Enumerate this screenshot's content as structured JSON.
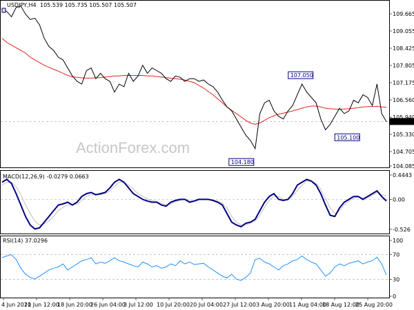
{
  "chart_data": [
    {
      "type": "candlestick",
      "panel": "price",
      "symbol_header": "USDJPY,H4",
      "ohlc_header": "105.539 105.735 105.507 105.507",
      "y_ticks": [
        "109.665",
        "109.055",
        "108.425",
        "107.805",
        "107.175",
        "106.560",
        "105.940",
        "105.330",
        "104.705",
        "104.085"
      ],
      "ylim": [
        103.8,
        110.0
      ],
      "last_price": "105.507",
      "annotations": [
        {
          "label": "107.050",
          "x": 64,
          "y": 107.05
        },
        {
          "label": "105.100",
          "x": 76,
          "y": 105.1
        },
        {
          "label": "104.180",
          "x": 54,
          "y": 104.18
        }
      ],
      "watermark": "ActionForex.com",
      "series": [
        {
          "name": "",
          "color": "#000000",
          "values": [
            109.7,
            109.6,
            109.4,
            109.75,
            109.8,
            109.5,
            109.3,
            109.35,
            109.1,
            108.6,
            108.3,
            108.15,
            107.9,
            107.8,
            107.5,
            107.2,
            107.0,
            106.9,
            107.4,
            107.5,
            107.1,
            107.3,
            107.1,
            107.0,
            106.6,
            106.9,
            106.8,
            107.3,
            107.0,
            107.2,
            107.6,
            107.3,
            107.5,
            107.4,
            107.3,
            107.1,
            107.0,
            107.2,
            107.15,
            107.0,
            107.1,
            107.1,
            107.0,
            107.05,
            106.9,
            106.8,
            106.6,
            106.3,
            106.05,
            105.9,
            105.6,
            105.3,
            105.0,
            104.8,
            104.5,
            105.8,
            106.2,
            106.3,
            105.9,
            105.7,
            105.6,
            105.9,
            106.1,
            106.5,
            106.9,
            106.6,
            106.4,
            106.2,
            105.6,
            105.2,
            105.4,
            105.7,
            106.0,
            105.8,
            105.9,
            106.3,
            106.2,
            106.5,
            106.4,
            106.1,
            106.9,
            105.8,
            105.5
          ]
        },
        {
          "name": "",
          "color": "#e02020",
          "values": [
            108.6,
            108.45,
            108.35,
            108.25,
            108.15,
            108.05,
            107.9,
            107.8,
            107.7,
            107.6,
            107.52,
            107.45,
            107.38,
            107.3,
            107.22,
            107.17,
            107.15,
            107.13,
            107.12,
            107.12,
            107.13,
            107.14,
            107.16,
            107.18,
            107.2,
            107.2,
            107.22,
            107.22,
            107.22,
            107.22,
            107.22,
            107.2,
            107.2,
            107.18,
            107.16,
            107.14,
            107.12,
            107.1,
            107.08,
            107.05,
            107.0,
            106.95,
            106.85,
            106.75,
            106.62,
            106.5,
            106.35,
            106.2,
            106.05,
            105.92,
            105.8,
            105.68,
            105.55,
            105.45,
            105.4,
            105.45,
            105.55,
            105.65,
            105.72,
            105.78,
            105.82,
            105.86,
            105.9,
            105.95,
            106.0,
            106.05,
            106.08,
            106.08,
            106.05,
            106.0,
            105.98,
            105.97,
            105.96,
            105.97,
            105.98,
            106.0,
            106.02,
            106.05,
            106.06,
            106.06,
            106.07,
            106.05,
            106.04
          ]
        }
      ]
    },
    {
      "type": "line",
      "panel": "macd",
      "label": "MACD(12,26,9) -0.0279 0.0663",
      "y_ticks": [
        "0.4443",
        "0.00",
        "-0.526"
      ],
      "ylim": [
        -0.6,
        0.5
      ],
      "series": [
        {
          "name": "",
          "color": "#000080",
          "values": [
            0.3,
            0.35,
            0.28,
            0.1,
            -0.1,
            -0.3,
            -0.45,
            -0.52,
            -0.5,
            -0.4,
            -0.3,
            -0.2,
            -0.1,
            -0.08,
            -0.05,
            -0.1,
            -0.05,
            0.05,
            0.1,
            0.12,
            0.08,
            0.1,
            0.12,
            0.2,
            0.3,
            0.35,
            0.3,
            0.2,
            0.1,
            0.05,
            0.0,
            -0.03,
            -0.05,
            -0.05,
            -0.1,
            -0.12,
            -0.05,
            -0.02,
            0.0,
            0.0,
            -0.05,
            -0.03,
            0.0,
            0.0,
            0.0,
            -0.02,
            -0.05,
            -0.1,
            -0.25,
            -0.4,
            -0.45,
            -0.48,
            -0.42,
            -0.4,
            -0.35,
            -0.2,
            -0.05,
            0.05,
            0.1,
            0.0,
            -0.02,
            0.0,
            0.1,
            0.25,
            0.3,
            0.35,
            0.32,
            0.25,
            0.1,
            -0.1,
            -0.28,
            -0.3,
            -0.15,
            -0.05,
            0.0,
            0.05,
            0.05,
            0.0,
            0.05,
            0.1,
            0.15,
            0.05,
            -0.03
          ]
        },
        {
          "name": "",
          "color": "#c0c0c0",
          "values": [
            0.25,
            0.3,
            0.3,
            0.22,
            0.08,
            -0.1,
            -0.25,
            -0.38,
            -0.45,
            -0.43,
            -0.38,
            -0.3,
            -0.2,
            -0.14,
            -0.1,
            -0.1,
            -0.08,
            -0.02,
            0.05,
            0.08,
            0.08,
            0.08,
            0.1,
            0.15,
            0.23,
            0.3,
            0.3,
            0.25,
            0.18,
            0.1,
            0.05,
            0.01,
            -0.02,
            -0.04,
            -0.07,
            -0.1,
            -0.08,
            -0.04,
            -0.02,
            0.0,
            -0.02,
            -0.03,
            -0.01,
            0.0,
            0.0,
            -0.01,
            -0.03,
            -0.07,
            -0.15,
            -0.3,
            -0.4,
            -0.45,
            -0.45,
            -0.42,
            -0.38,
            -0.28,
            -0.14,
            -0.02,
            0.06,
            0.05,
            0.0,
            -0.01,
            0.05,
            0.16,
            0.25,
            0.32,
            0.32,
            0.28,
            0.18,
            0.02,
            -0.15,
            -0.25,
            -0.2,
            -0.1,
            -0.03,
            0.02,
            0.04,
            0.02,
            0.03,
            0.07,
            0.12,
            0.08,
            0.07
          ]
        }
      ]
    },
    {
      "type": "line",
      "panel": "rsi",
      "label": "RSI(14) 37.0296",
      "y_ticks": [
        "100",
        "70",
        "30",
        "0"
      ],
      "ylim": [
        0,
        100
      ],
      "series": [
        {
          "name": "",
          "color": "#1e90ff",
          "values": [
            65,
            68,
            70,
            62,
            48,
            38,
            33,
            30,
            35,
            40,
            45,
            48,
            50,
            55,
            45,
            50,
            55,
            60,
            62,
            65,
            55,
            58,
            56,
            60,
            65,
            60,
            58,
            55,
            52,
            50,
            58,
            55,
            50,
            52,
            48,
            50,
            55,
            52,
            60,
            55,
            58,
            54,
            55,
            56,
            50,
            45,
            40,
            35,
            32,
            38,
            30,
            28,
            33,
            40,
            62,
            64,
            58,
            55,
            50,
            45,
            52,
            55,
            60,
            62,
            68,
            62,
            58,
            55,
            45,
            35,
            40,
            50,
            55,
            52,
            56,
            58,
            60,
            55,
            58,
            60,
            66,
            55,
            37
          ]
        }
      ]
    }
  ],
  "x_axis": {
    "ticks": [
      "4 Jun 2020",
      "11 Jun 12:00",
      "18 Jun 20:00",
      "26 Jun 04:00",
      "3 Jul 12:00",
      "10 Jul 20:00",
      "20 Jul 04:00",
      "27 Jul 12:00",
      "3 Aug 20:00",
      "11 Aug 04:00",
      "18 Aug 12:00",
      "25 Aug 20:00"
    ]
  },
  "colors": {
    "price": "#000000",
    "ma": "#e02020",
    "macd": "#000080",
    "signal": "#c0c0c0",
    "rsi": "#1e90ff",
    "label_box": "#000080",
    "grid": "#a0a0a0"
  }
}
